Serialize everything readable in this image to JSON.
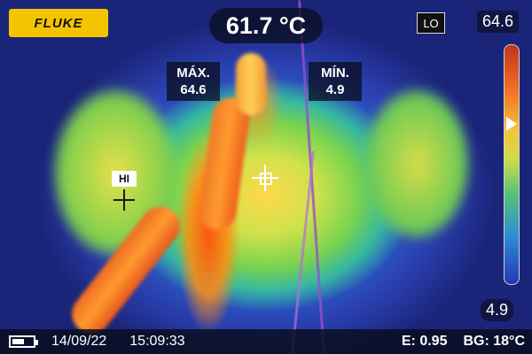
{
  "brand": {
    "logo_text": "FLUKE",
    "color": "#f5c400"
  },
  "readout": {
    "center_temp": "61.7 °C"
  },
  "range_mode": "LO",
  "scale": {
    "max": "64.6",
    "min": "4.9",
    "pointer_level": 0.33
  },
  "max_box": {
    "label": "MÁX.",
    "value": "64.6"
  },
  "min_box": {
    "label": "MÍN.",
    "value": "4.9"
  },
  "hotspot": {
    "label": "HI"
  },
  "status_bar": {
    "battery_level": 0.6,
    "date": "14/09/22",
    "time": "15:09:33",
    "emissivity": "E: 0.95",
    "background": "BG: 18°C"
  },
  "icons": [
    "battery-icon",
    "crosshair-icon",
    "hi-marker-icon",
    "scale-pointer-icon"
  ]
}
